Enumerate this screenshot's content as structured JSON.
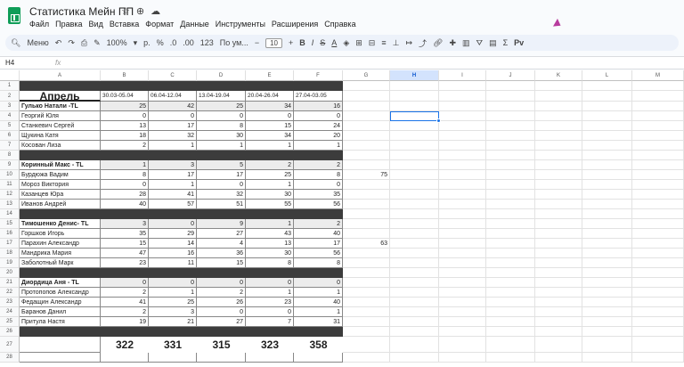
{
  "app": {
    "title": "Статистика Мейн ПП",
    "menu": [
      "Файл",
      "Правка",
      "Вид",
      "Вставка",
      "Формат",
      "Данные",
      "Инструменты",
      "Расширения",
      "Справка"
    ],
    "icons": [
      "star-icon",
      "move-icon",
      "cloud-icon"
    ]
  },
  "toolbar": {
    "search": "Меню",
    "zoom": "100%",
    "currency": "р.",
    "percent": "%",
    "dec_less": ".0",
    "dec_more": ".00",
    "format_123": "123",
    "font": "По ум...",
    "font_size": "10",
    "more": "Pv"
  },
  "formula_bar": {
    "cell_ref": "H4",
    "fx": "fx"
  },
  "grid": {
    "columns": [
      "A",
      "B",
      "C",
      "D",
      "E",
      "F",
      "G",
      "H",
      "I",
      "J",
      "K",
      "L",
      "M"
    ],
    "selected_column": "H",
    "title": "Апрель",
    "periods": [
      "30.03-05.04",
      "06.04-12.04",
      "13.04-19.04",
      "20.04-26.04",
      "27.04-03.05"
    ],
    "groups": [
      {
        "lead": "Гулько Натали -TL",
        "lead_values": [
          25,
          42,
          25,
          34,
          16
        ],
        "rows": [
          {
            "name": "Георгий Юля",
            "values": [
              0,
              0,
              0,
              0,
              0
            ]
          },
          {
            "name": "Станкевич Сергей",
            "values": [
              13,
              17,
              8,
              15,
              24
            ]
          },
          {
            "name": "Щукина Катя",
            "values": [
              18,
              32,
              30,
              34,
              20
            ]
          },
          {
            "name": "Косован Лиза",
            "values": [
              2,
              1,
              1,
              1,
              1
            ]
          }
        ]
      },
      {
        "lead": "Коринный Макс - TL",
        "lead_values": [
          1,
          3,
          5,
          2,
          2
        ],
        "rows": [
          {
            "name": "Бурдюжа Вадим",
            "values": [
              8,
              17,
              17,
              25,
              8
            ],
            "g": "75"
          },
          {
            "name": "Мороз Виктория",
            "values": [
              0,
              1,
              0,
              1,
              0
            ]
          },
          {
            "name": "Казанцев Юра",
            "values": [
              28,
              41,
              32,
              30,
              35
            ]
          },
          {
            "name": "Иванов Андрей",
            "values": [
              40,
              57,
              51,
              55,
              56
            ]
          }
        ]
      },
      {
        "lead": "Тимошенко Денис- TL",
        "lead_values": [
          3,
          0,
          9,
          1,
          2
        ],
        "rows": [
          {
            "name": "Горшков Игорь",
            "values": [
              35,
              29,
              27,
              43,
              40
            ]
          },
          {
            "name": "Парахин Александр",
            "values": [
              15,
              14,
              4,
              13,
              17
            ],
            "g": "63"
          },
          {
            "name": "Мандрика Мария",
            "values": [
              47,
              16,
              36,
              30,
              56
            ]
          },
          {
            "name": "Заболотный Марк",
            "values": [
              23,
              11,
              15,
              8,
              8
            ]
          }
        ]
      },
      {
        "lead": "Диордица Аня - TL",
        "lead_values": [
          0,
          0,
          0,
          0,
          0
        ],
        "rows": [
          {
            "name": "Протопопов Александр",
            "values": [
              2,
              1,
              2,
              1,
              1
            ]
          },
          {
            "name": "Федащин Александр",
            "values": [
              41,
              25,
              26,
              23,
              40
            ]
          },
          {
            "name": "Баранов Данил",
            "values": [
              2,
              3,
              0,
              0,
              1
            ]
          },
          {
            "name": "Притула Настя",
            "values": [
              19,
              21,
              27,
              7,
              31
            ]
          }
        ]
      }
    ],
    "totals": [
      "322",
      "331",
      "315",
      "323",
      "358"
    ]
  }
}
